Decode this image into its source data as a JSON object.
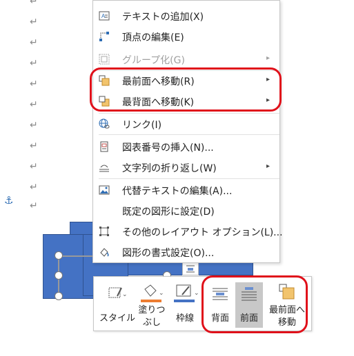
{
  "document": {
    "paragraph_mark": "↵",
    "anchor_icon": "anchor-icon"
  },
  "context_menu": {
    "items": [
      {
        "label": "テキストの追加(X)",
        "icon": "add-text-icon",
        "disabled": false,
        "submenu": false
      },
      {
        "label": "頂点の編集(E)",
        "icon": "edit-points-icon",
        "disabled": false,
        "submenu": false
      },
      {
        "label": "グループ化(G)",
        "icon": "group-icon",
        "disabled": true,
        "submenu": true
      },
      {
        "label": "最前面へ移動(R)",
        "icon": "bring-to-front-icon",
        "disabled": false,
        "submenu": true
      },
      {
        "label": "最背面へ移動(K)",
        "icon": "send-to-back-icon",
        "disabled": false,
        "submenu": true
      },
      {
        "label": "リンク(I)",
        "icon": "link-icon",
        "disabled": false,
        "submenu": false
      },
      {
        "label": "図表番号の挿入(N)...",
        "icon": "insert-caption-icon",
        "disabled": false,
        "submenu": false
      },
      {
        "label": "文字列の折り返し(W)",
        "icon": "wrap-text-icon",
        "disabled": false,
        "submenu": true
      },
      {
        "label": "代替テキストの編集(A)...",
        "icon": "alt-text-icon",
        "disabled": false,
        "submenu": false
      },
      {
        "label": "既定の図形に設定(D)",
        "icon": "",
        "disabled": false,
        "submenu": false
      },
      {
        "label": "その他のレイアウト オプション(L)...",
        "icon": "layout-options-icon",
        "disabled": false,
        "submenu": false
      },
      {
        "label": "図形の書式設定(O)...",
        "icon": "format-shape-icon",
        "disabled": false,
        "submenu": false
      }
    ],
    "submenu_arrow": "▸"
  },
  "mini_toolbar": {
    "style_label": "スタイル",
    "fill_label_1": "塗りつ",
    "fill_label_2": "ぶし",
    "outline_label": "枠線",
    "back_label": "背面",
    "front_label": "前面",
    "bring_front_label_1": "最前面へ",
    "bring_front_label_2": "移動",
    "dropdown_arrow": "⌄"
  },
  "colors": {
    "shape_fill": "#4472c4",
    "fill_accent": "#ed7d31",
    "outline_accent": "#4472c4",
    "highlight": "#e0101a"
  }
}
